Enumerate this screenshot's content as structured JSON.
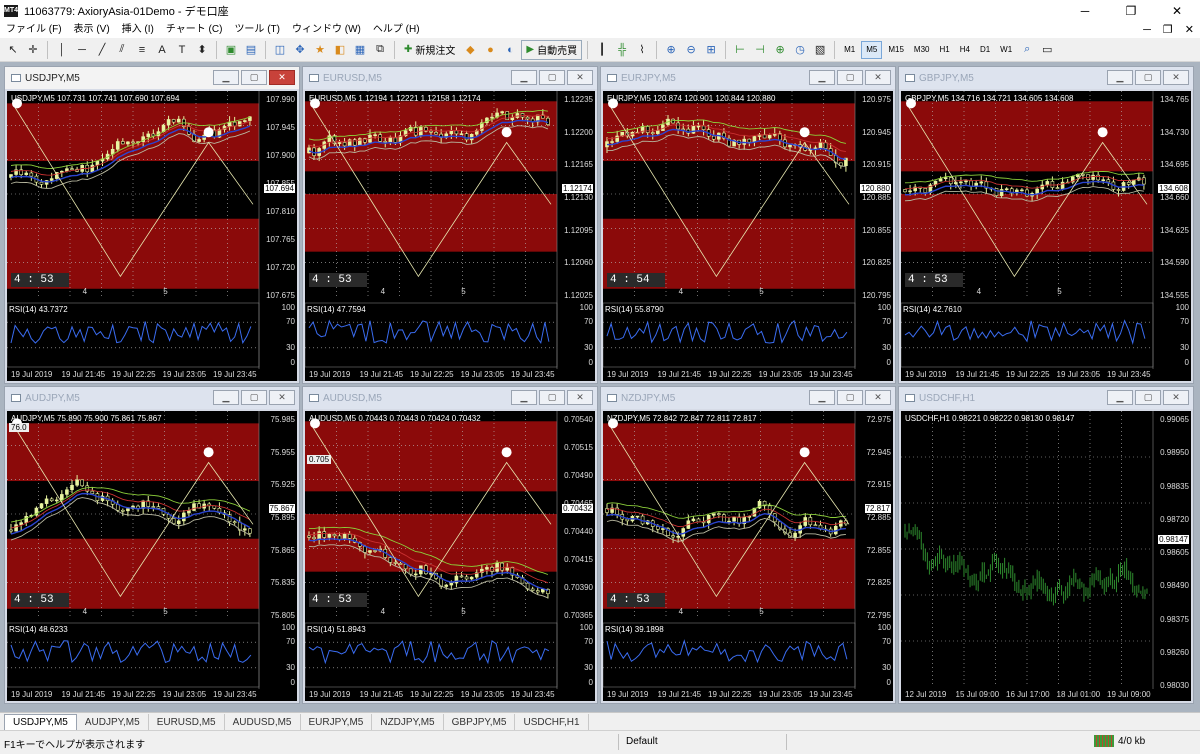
{
  "window": {
    "title": "11063779: AxioryAsia-01Demo - デモ口座",
    "app_badge": "MT4",
    "minimize": "─",
    "maximize": "❐",
    "close": "✕"
  },
  "menu": {
    "items": [
      "ファイル (F)",
      "表示 (V)",
      "挿入 (I)",
      "チャート (C)",
      "ツール (T)",
      "ウィンドウ (W)",
      "ヘルプ (H)"
    ],
    "right": [
      "─",
      "❐",
      "✕"
    ]
  },
  "toolbar": {
    "new_order": "新規注文",
    "auto_trade": "自動売買",
    "timeframes": [
      "M1",
      "M5",
      "M15",
      "M30",
      "H1",
      "H4",
      "D1",
      "W1"
    ],
    "active_timeframe": "M5"
  },
  "charts": [
    {
      "id": "usdjpy",
      "title": "USDJPY,M5",
      "active": true,
      "info": "USDJPY,M5  107.731 107.741 107.690 107.694",
      "prices": [
        "107.990",
        "107.945",
        "107.900",
        "107.855",
        "107.810",
        "107.765",
        "107.720",
        "107.675"
      ],
      "current": "107.694",
      "timer": "4 : 53",
      "days": [
        "4",
        "5"
      ],
      "rsi": "RSI(14) 43.7372",
      "times": [
        "19 Jul 2019",
        "19 Jul 21:45",
        "19 Jul 22:25",
        "19 Jul 23:05",
        "19 Jul 23:45"
      ]
    },
    {
      "id": "eurusd",
      "title": "EURUSD,M5",
      "active": false,
      "info": "EURUSD,M5  1.12194 1.12221 1.12158 1.12174",
      "prices": [
        "1.12235",
        "1.12200",
        "1.12165",
        "1.12130",
        "1.12095",
        "1.12060",
        "1.12025"
      ],
      "current": "1.12174",
      "timer": "4 : 53",
      "days": [
        "4",
        "5"
      ],
      "rsi": "RSI(14) 47.7594",
      "times": [
        "19 Jul 2019",
        "19 Jul 21:45",
        "19 Jul 22:25",
        "19 Jul 23:05",
        "19 Jul 23:45"
      ]
    },
    {
      "id": "eurjpy",
      "title": "EURJPY,M5",
      "active": false,
      "info": "EURJPY,M5  120.874 120.901 120.844 120.880",
      "prices": [
        "120.975",
        "120.945",
        "120.915",
        "120.885",
        "120.855",
        "120.825",
        "120.795"
      ],
      "current": "120.880",
      "timer": "4 : 54",
      "days": [
        "4",
        "5"
      ],
      "rsi": "RSI(14) 55.8790",
      "times": [
        "19 Jul 2019",
        "19 Jul 21:45",
        "19 Jul 22:25",
        "19 Jul 23:05",
        "19 Jul 23:45"
      ]
    },
    {
      "id": "gbpjpy",
      "title": "GBPJPY,M5",
      "active": false,
      "info": "GBPJPY,M5  134.716 134.721 134.605 134.608",
      "prices": [
        "134.765",
        "134.730",
        "134.695",
        "134.660",
        "134.625",
        "134.590",
        "134.555"
      ],
      "current": "134.608",
      "timer": "4 : 53",
      "days": [
        "4",
        "5"
      ],
      "rsi": "RSI(14) 42.7610",
      "times": [
        "19 Jul 2019",
        "19 Jul 21:45",
        "19 Jul 22:25",
        "19 Jul 23:05",
        "19 Jul 23:45"
      ]
    },
    {
      "id": "audjpy",
      "title": "AUDJPY,M5",
      "active": false,
      "info": "AUDJPY,M5  75.890 75.900 75.861 75.867",
      "prices": [
        "75.985",
        "75.955",
        "75.925",
        "75.895",
        "75.865",
        "75.835",
        "75.805"
      ],
      "current": "75.867",
      "timer": "4 : 53",
      "days": [
        "4",
        "5"
      ],
      "rsi": "RSI(14) 48.6233",
      "times": [
        "19 Jul 2019",
        "19 Jul 21:45",
        "19 Jul 22:25",
        "19 Jul 23:05",
        "19 Jul 23:45"
      ],
      "tag": "76.0"
    },
    {
      "id": "audusd",
      "title": "AUDUSD,M5",
      "active": false,
      "info": "AUDUSD,M5  0.70443 0.70443 0.70424 0.70432",
      "prices": [
        "0.70540",
        "0.70515",
        "0.70490",
        "0.70465",
        "0.70440",
        "0.70415",
        "0.70390",
        "0.70365"
      ],
      "current": "0.70432",
      "timer": "4 : 53",
      "days": [
        "4",
        "5"
      ],
      "rsi": "RSI(14) 51.8943",
      "times": [
        "19 Jul 2019",
        "19 Jul 21:45",
        "19 Jul 22:25",
        "19 Jul 23:05",
        "19 Jul 23:45"
      ],
      "tag": "0.705"
    },
    {
      "id": "nzdjpy",
      "title": "NZDJPY,M5",
      "active": false,
      "info": "NZDJPY,M5  72.842 72.847 72.811 72.817",
      "prices": [
        "72.975",
        "72.945",
        "72.915",
        "72.885",
        "72.855",
        "72.825",
        "72.795"
      ],
      "current": "72.817",
      "timer": "4 : 53",
      "days": [
        "4",
        "5"
      ],
      "rsi": "RSI(14) 39.1898",
      "times": [
        "19 Jul 2019",
        "19 Jul 21:45",
        "19 Jul 22:25",
        "19 Jul 23:05",
        "19 Jul 23:45"
      ]
    },
    {
      "id": "usdchf",
      "title": "USDCHF,H1",
      "active": false,
      "info": "USDCHF,H1  0.98221 0.98222 0.98130 0.98147",
      "prices": [
        "0.99065",
        "0.98950",
        "0.98835",
        "0.98720",
        "0.98605",
        "0.98490",
        "0.98375",
        "0.98260",
        "0.98030"
      ],
      "current": "0.98147",
      "times": [
        "12 Jul 2019",
        "15 Jul 09:00",
        "16 Jul 17:00",
        "18 Jul 01:00",
        "19 Jul 09:00"
      ]
    }
  ],
  "rsi_levels": [
    "100",
    "70",
    "30",
    "0"
  ],
  "tabs": [
    "USDJPY,M5",
    "AUDJPY,M5",
    "EURUSD,M5",
    "AUDUSD,M5",
    "EURJPY,M5",
    "NZDJPY,M5",
    "GBPJPY,M5",
    "USDCHF,H1"
  ],
  "status": {
    "help": "F1キーでヘルプが表示されます",
    "profile": "Default",
    "connection": "4/0 kb"
  },
  "colors": {
    "zone_red": "#8b0a0a",
    "candle": "#e8f3a0",
    "grid": "#bbbbbb",
    "usdchf_bars": "#2e8b2e"
  }
}
